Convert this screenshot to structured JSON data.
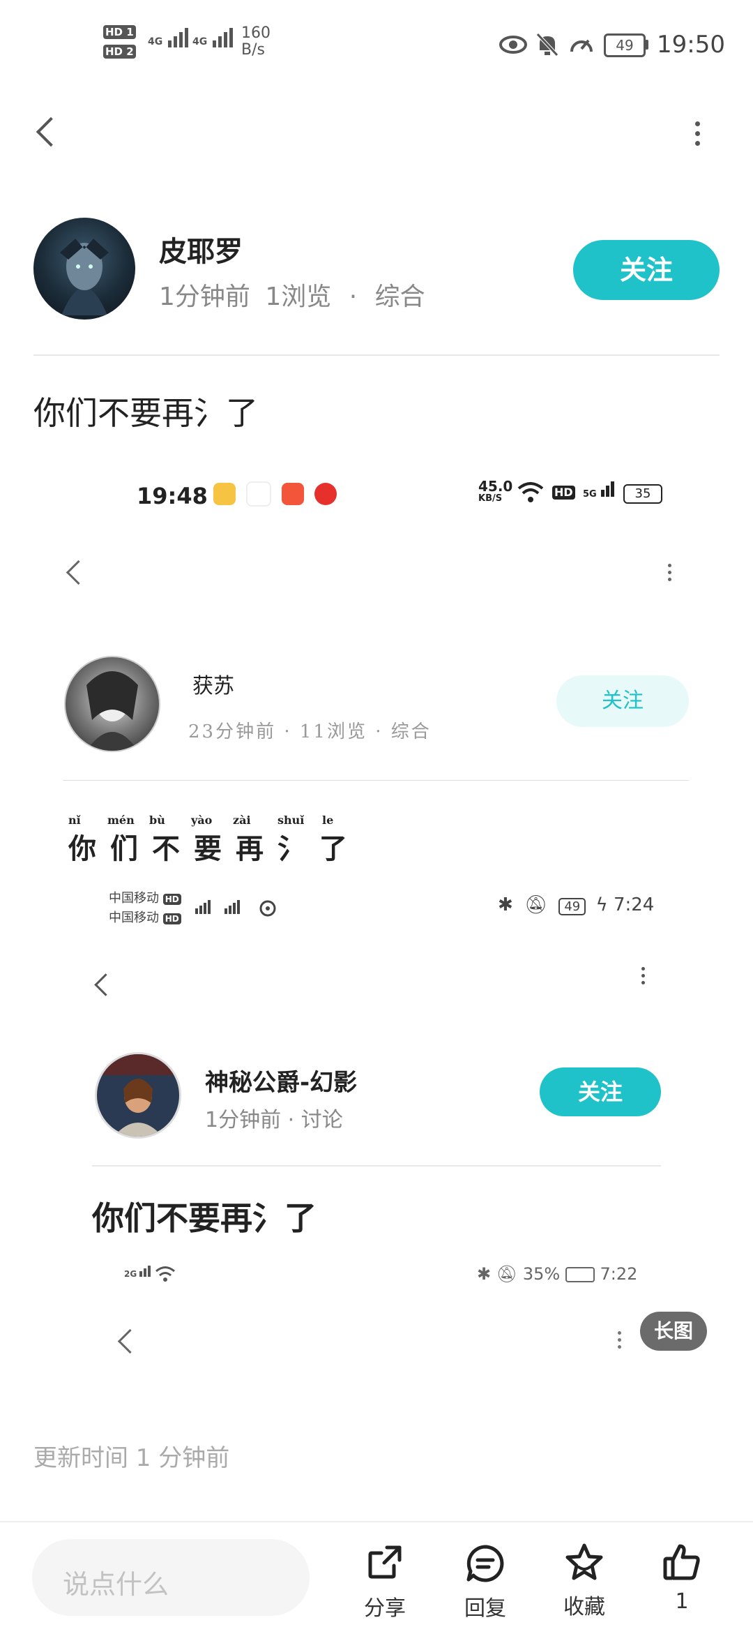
{
  "status_bar": {
    "net_speed_top": "160",
    "net_speed_unit": "B/s",
    "battery": "49",
    "time": "19:50",
    "sim1": "HD 1",
    "sim2": "HD 2",
    "net_type": "4G"
  },
  "post": {
    "author": "皮耶罗",
    "time": "1分钟前",
    "views": "1浏览",
    "separator": "·",
    "category": "综合",
    "follow_label": "关注",
    "body": "你们不要再氵了"
  },
  "embed1": {
    "status_time": "19:48",
    "net_speed": "45.0",
    "net_speed_unit": "KB/S",
    "hd": "HD",
    "network": "5G",
    "battery": "35",
    "author": "获苏",
    "meta": "23分钟前 · 11浏览 · 综合",
    "follow_label": "关注",
    "body": "你们不要再氵了",
    "pinyin": [
      "nǐ",
      "mén",
      "bù",
      "yào",
      "zài",
      "shuǐ",
      "le"
    ]
  },
  "embed2": {
    "carrier1": "中国移动",
    "carrier2": "中国移动",
    "hd": "HD",
    "battery": "49",
    "time": "7:24",
    "author": "神秘公爵-幻影",
    "meta": "1分钟前 · 讨论",
    "follow_label": "关注",
    "body": "你们不要再氵了"
  },
  "embed3": {
    "network": "2G",
    "battery_pct": "35%",
    "time": "7:22",
    "long_image_label": "长图"
  },
  "update_time": "更新时间 1 分钟前",
  "bottom_bar": {
    "comment_placeholder": "说点什么",
    "share": "分享",
    "reply": "回复",
    "favorite": "收藏",
    "like_count": "1"
  },
  "colors": {
    "accent": "#1ec2c8",
    "badge_bg": "#6b6b6b"
  }
}
